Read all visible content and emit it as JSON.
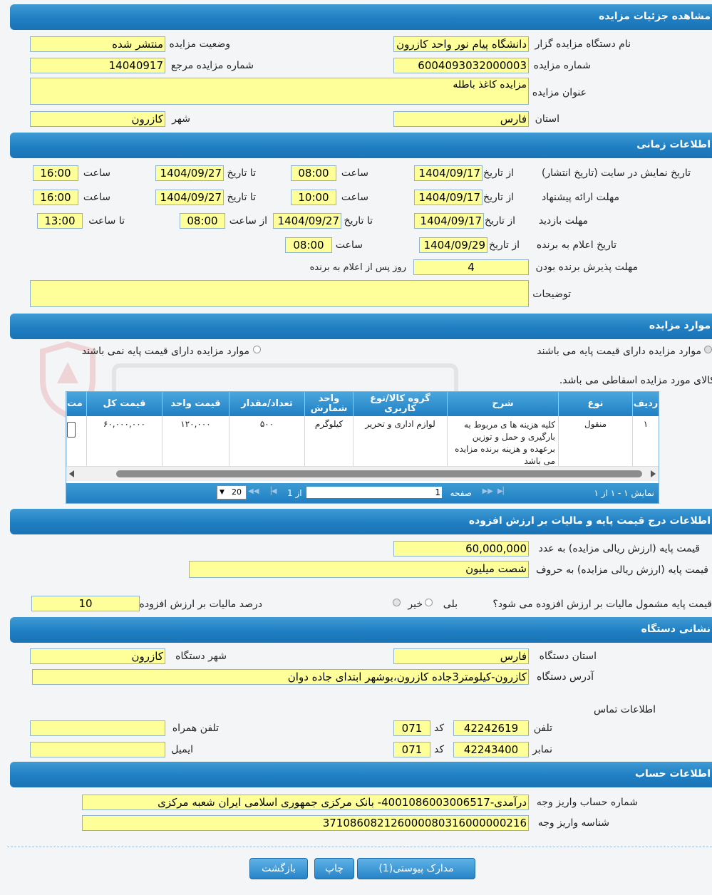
{
  "sections": {
    "details": "مشاهده جزئیات مزایده",
    "timing": "اطلاعات زمانی",
    "items": "موارد مزایده",
    "price": "اطلاعات درج قیمت پایه و مالیات بر ارزش افزوده",
    "address": "نشانی دستگاه",
    "account": "اطلاعات حساب"
  },
  "details": {
    "org_label": "نام دستگاه مزایده گزار",
    "org_value": "دانشگاه پیام نور واحد کازرون",
    "status_label": "وضعیت مزایده",
    "status_value": "منتشر شده",
    "number_label": "شماره مزایده",
    "number_value": "6004093032000003",
    "ref_label": "شماره مزایده مرجع",
    "ref_value": "14040917",
    "title_label": "عنوان مزایده",
    "title_value": "مزایده کاغذ باطله",
    "province_label": "استان",
    "province_value": "فارس",
    "city_label": "شهر",
    "city_value": "کازرون"
  },
  "timing": {
    "display_label": "تاریخ نمایش در سایت (تاریخ انتشار)",
    "from_date_label": "از تاریخ",
    "to_date_label": "تا تاریخ",
    "time_label": "ساعت",
    "from_time_label": "از ساعت",
    "to_time_label": "تا ساعت",
    "display_from_date": "1404/09/17",
    "display_from_time": "08:00",
    "display_to_date": "1404/09/27",
    "display_to_time": "16:00",
    "offer_label": "مهلت ارائه پیشنهاد",
    "offer_from_date": "1404/09/17",
    "offer_from_time": "10:00",
    "offer_to_date": "1404/09/27",
    "offer_to_time": "16:00",
    "visit_label": "مهلت بازدید",
    "visit_from_date": "1404/09/17",
    "visit_to_date": "1404/09/27",
    "visit_from_time": "08:00",
    "visit_to_time": "13:00",
    "announce_label": "تاریخ اعلام به برنده",
    "announce_date": "1404/09/29",
    "announce_time": "08:00",
    "accept_label": "مهلت پذیرش برنده بودن",
    "accept_days": "4",
    "accept_suffix": "روز پس از اعلام به برنده",
    "notes_label": "توضیحات",
    "notes_value": ""
  },
  "items": {
    "radio_has_price": "موارد مزایده دارای قیمت پایه می باشند",
    "radio_no_price": "موارد مزایده دارای قیمت پایه نمی باشند",
    "notice": "کالای مورد مزایده اسقاطی می باشد.",
    "headers": [
      "ردیف",
      "نوع",
      "شرح",
      "گروه کالا/نوع کاربری",
      "واحد شمارش",
      "تعداد/مقدار",
      "قیمت واحد",
      "قیمت کل",
      "مت"
    ],
    "rows": [
      {
        "row": "۱",
        "type": "منقول",
        "desc": "کلیه هزینه ها ی مربوط به بارگیری و حمل و توزین برعهده و هزینه برنده مزایده می باشد",
        "group": "لوازم اداری و تحریر",
        "unit": "کیلوگرم",
        "qty": "۵۰۰",
        "unit_price": "۱۲۰,۰۰۰",
        "total": "۶۰,۰۰۰,۰۰۰"
      }
    ],
    "pager": {
      "page_label": "صفحه",
      "page_value": "1",
      "of_label": "از 1",
      "page_size": "20",
      "summary": "نمایش ۱ - ۱ از ۱"
    }
  },
  "price": {
    "base_num_label": "قیمت پایه (ارزش ریالی مزایده) به عدد",
    "base_num_value": "60,000,000",
    "base_word_label": "قیمت پایه (ارزش ریالی مزایده) به حروف",
    "base_word_value": "شصت میلیون",
    "vat_question": "قیمت پایه مشمول مالیات بر ارزش افزوده می شود؟",
    "yes_label": "بلی",
    "no_label": "خیر",
    "vat_pct_label": "درصد مالیات بر ارزش افزوده",
    "vat_pct_value": "10"
  },
  "address": {
    "province_label": "استان دستگاه",
    "province_value": "فارس",
    "city_label": "شهر دستگاه",
    "city_value": "کازرون",
    "addr_label": "آدرس دستگاه",
    "addr_value": "کازرون-کیلومتر3جاده کازرون،بوشهر ابتدای جاده دوان",
    "contact_label": "اطلاعات تماس",
    "phone_label": "تلفن",
    "phone_value": "42242619",
    "phone_code_label": "کد",
    "phone_code": "071",
    "fax_label": "نمابر",
    "fax_value": "42243400",
    "fax_code_label": "کد",
    "fax_code": "071",
    "mobile_label": "تلفن همراه",
    "mobile_value": "",
    "email_label": "ایمیل",
    "email_value": ""
  },
  "account": {
    "acc_label": "شماره حساب واریز وجه",
    "acc_value": "درآمدی-4001086003006517- بانک مرکزی جمهوری اسلامی ایران شعبه مرکزی",
    "id_label": "شناسه واریز وجه",
    "id_value": "371086082126000080316000000216"
  },
  "buttons": {
    "attachments": "مدارک پیوستی(1)",
    "print": "چاپ",
    "back": "بازگشت"
  }
}
